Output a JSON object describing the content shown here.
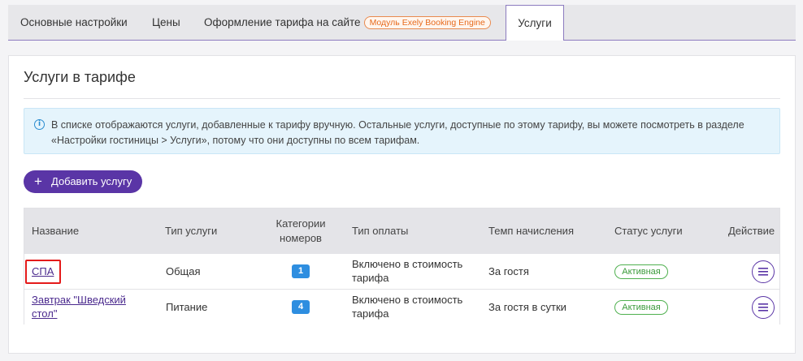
{
  "tabs": {
    "main_settings": "Основные настройки",
    "prices": "Цены",
    "site_design": "Оформление тарифа на сайте",
    "module_badge": "Модуль Exely Booking Engine",
    "services": "Услуги"
  },
  "panel": {
    "title": "Услуги в тарифе",
    "info_text": "В списке отображаются услуги, добавленные к тарифу вручную. Остальные услуги, доступные по этому тарифу, вы можете посмотреть в разделе «Настройки гостиницы > Услуги», потому что они доступны по всем тарифам.",
    "add_button": "Добавить услугу"
  },
  "table": {
    "headers": {
      "name": "Название",
      "type": "Тип услуги",
      "categories": "Категории номеров",
      "payment": "Тип оплаты",
      "rate": "Темп начисления",
      "status": "Статус услуги",
      "action": "Действие"
    },
    "rows": [
      {
        "name": "СПА",
        "type": "Общая",
        "categories": "1",
        "payment": "Включено в стоимость тарифа",
        "rate": "За гостя",
        "status": "Активная"
      },
      {
        "name": "Завтрак \"Шведский стол\"",
        "type": "Питание",
        "categories": "4",
        "payment": "Включено в стоимость тарифа",
        "rate": "За гостя в сутки",
        "status": "Активная"
      }
    ]
  },
  "colors": {
    "accent": "#5a35a6",
    "info_bg": "#e5f4fc",
    "count_badge": "#2e8ee0",
    "status_active": "#3a9a3a",
    "highlight": "#e41a1a",
    "module_badge": "#e76a1c"
  }
}
